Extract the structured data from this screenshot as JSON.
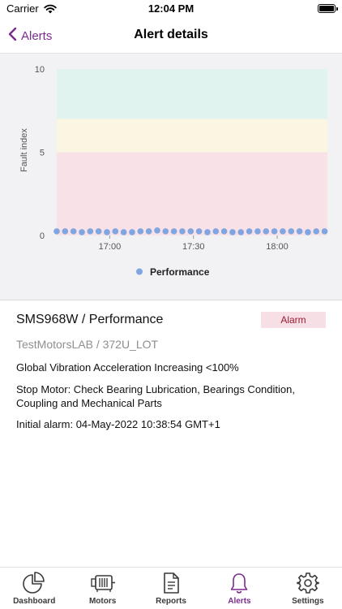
{
  "status_bar": {
    "carrier": "Carrier",
    "time": "12:04 PM"
  },
  "nav": {
    "back_label": "Alerts",
    "title": "Alert details"
  },
  "colors": {
    "accent": "#7b2c8f",
    "zone_green": "#e1f3ee",
    "zone_yellow": "#fbf6e1",
    "zone_red": "#f8e2e8",
    "series": "#7fa6e0"
  },
  "chart_data": {
    "type": "scatter",
    "title": "",
    "xlabel": "",
    "ylabel": "Fault index",
    "ylim": [
      0,
      10
    ],
    "yticks": [
      "0",
      "5",
      "10"
    ],
    "xticks": [
      "17:00",
      "17:30",
      "18:00"
    ],
    "xlim": [
      "16:41",
      "18:18"
    ],
    "bands": [
      {
        "from": 7,
        "to": 10,
        "color": "green"
      },
      {
        "from": 5,
        "to": 7,
        "color": "yellow"
      },
      {
        "from": 0,
        "to": 5,
        "color": "red"
      }
    ],
    "legend_position": "bottom",
    "series": [
      {
        "name": "Performance",
        "x": [
          "16:41",
          "16:44",
          "16:47",
          "16:50",
          "16:53",
          "16:56",
          "16:59",
          "17:02",
          "17:05",
          "17:08",
          "17:11",
          "17:14",
          "17:17",
          "17:20",
          "17:23",
          "17:26",
          "17:29",
          "17:32",
          "17:35",
          "17:38",
          "17:41",
          "17:44",
          "17:47",
          "17:50",
          "17:53",
          "17:56",
          "17:59",
          "18:02",
          "18:05",
          "18:08",
          "18:11",
          "18:14",
          "18:17"
        ],
        "values": [
          0.25,
          0.25,
          0.25,
          0.2,
          0.25,
          0.25,
          0.2,
          0.25,
          0.2,
          0.2,
          0.25,
          0.25,
          0.3,
          0.25,
          0.25,
          0.25,
          0.25,
          0.25,
          0.2,
          0.25,
          0.25,
          0.2,
          0.2,
          0.25,
          0.25,
          0.25,
          0.25,
          0.25,
          0.25,
          0.25,
          0.2,
          0.25,
          0.25
        ]
      }
    ]
  },
  "alert": {
    "title": "SMS968W / Performance",
    "badge": "Alarm",
    "location": "TestMotorsLAB / 372U_LOT",
    "description": "Global Vibration Acceleration Increasing <100%",
    "action": "Stop Motor: Check Bearing Lubrication, Bearings Condition, Coupling and Mechanical Parts",
    "initial_alarm": "Initial alarm: 04-May-2022 10:38:54 GMT+1"
  },
  "tabs": [
    {
      "label": "Dashboard",
      "icon": "pie-chart-icon"
    },
    {
      "label": "Motors",
      "icon": "motor-icon"
    },
    {
      "label": "Reports",
      "icon": "document-icon"
    },
    {
      "label": "Alerts",
      "icon": "bell-icon",
      "active": true
    },
    {
      "label": "Settings",
      "icon": "gear-icon"
    }
  ]
}
